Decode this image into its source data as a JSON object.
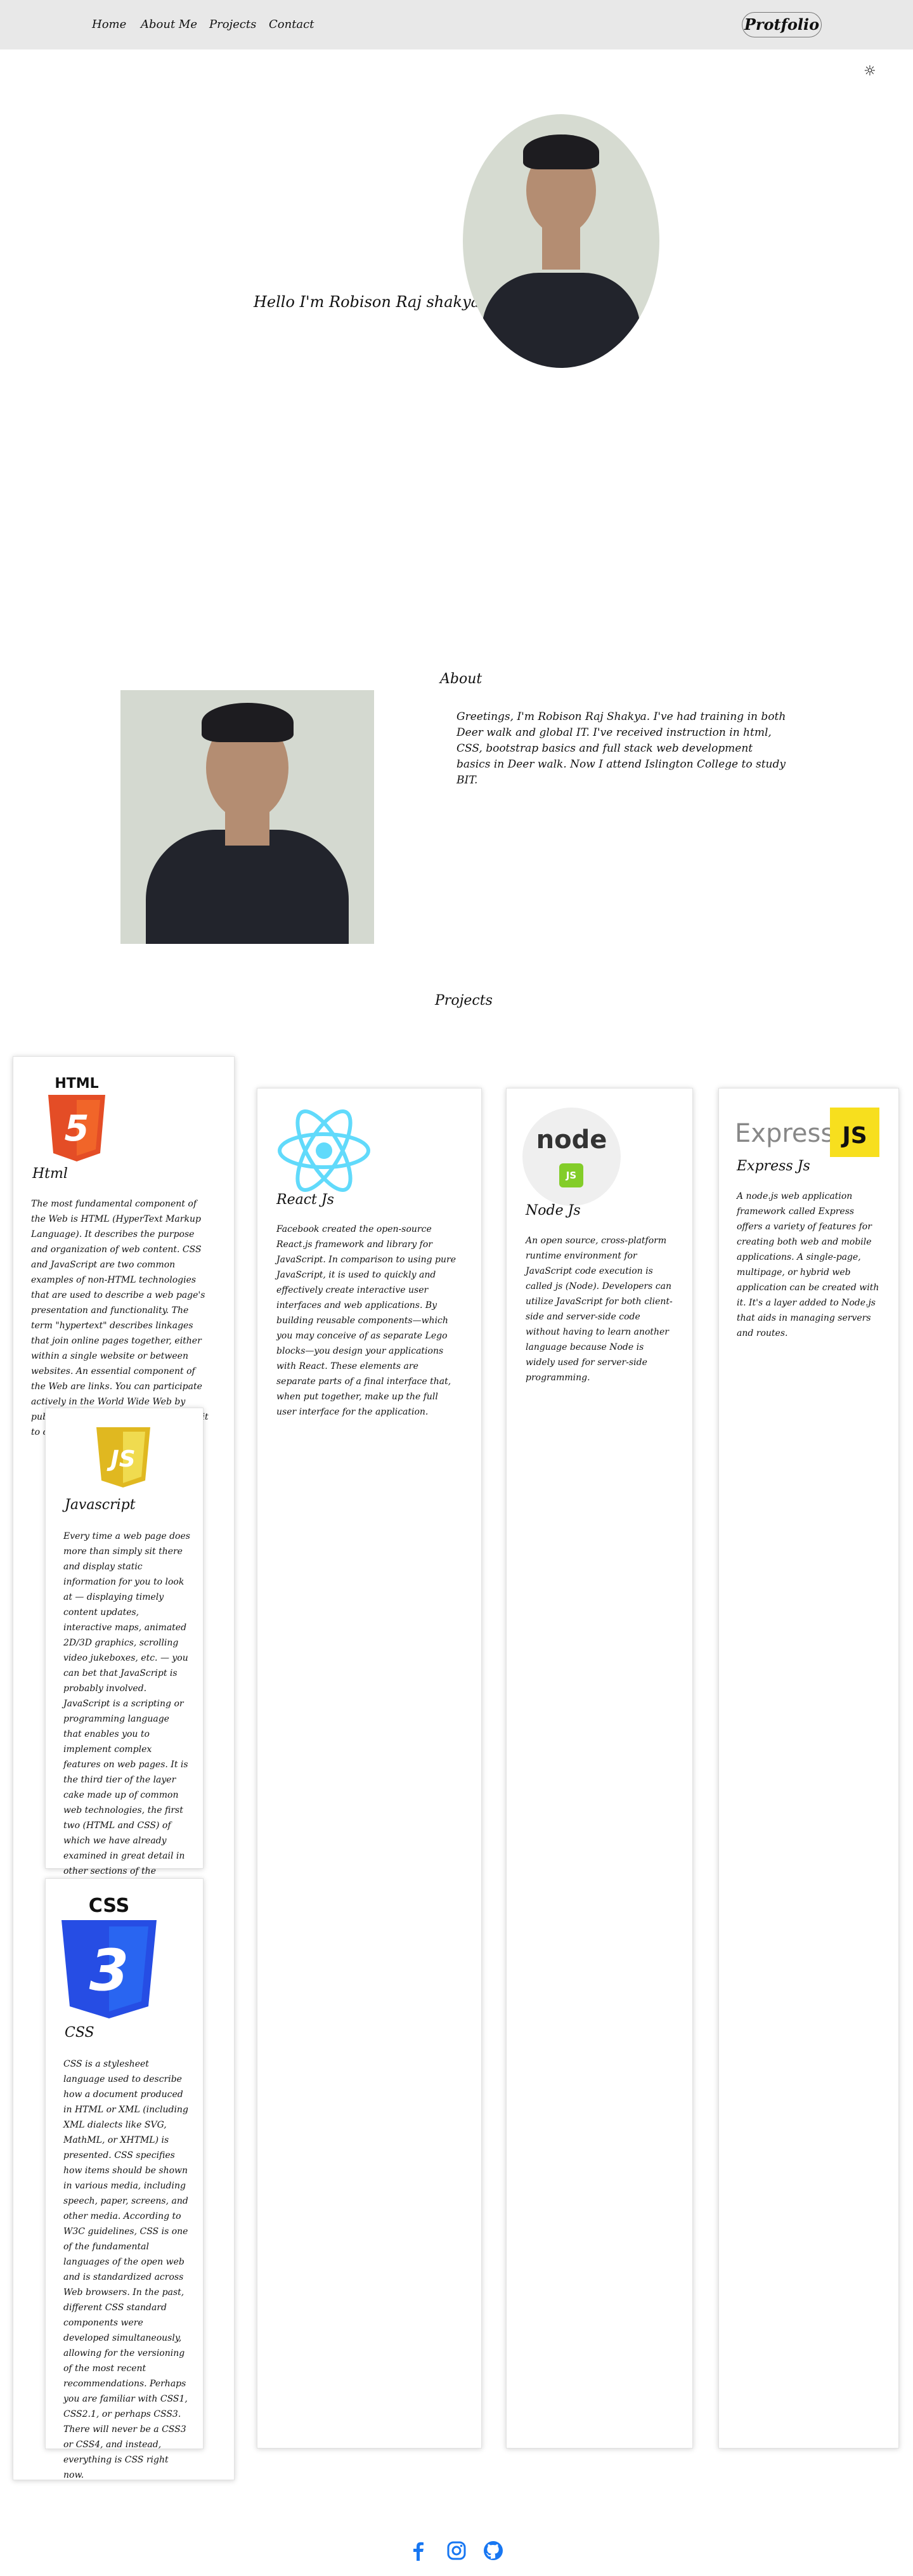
{
  "nav": {
    "items": [
      "Home",
      "About Me",
      "Projects",
      "Contact"
    ],
    "logo": "Protfolio",
    "theme_icon": "sun-icon"
  },
  "hero": {
    "greeting": "Hello I'm Robison Raj shakya"
  },
  "about": {
    "title": "About",
    "text": "Greetings, I'm Robison Raj Shakya. I've had training in both Deer walk and global IT. I've received instruction in html, CSS, bootstrap basics and full stack web development basics in Deer walk. Now I attend Islington College to study BIT."
  },
  "projects": {
    "title": "Projects",
    "cards": [
      {
        "name": "Html",
        "logo_text": "HTML",
        "logo_badge": "5",
        "desc": "The most fundamental component of the Web is HTML (HyperText Markup Language). It describes the purpose and organization of web content. CSS and JavaScript are two common examples of non-HTML technologies that are used to describe a web page's presentation and functionality. The term \"hypertext\" describes linkages that join online pages together, either within a single website or between websites. An essential component of the Web are links. You can participate actively in the World Wide Web by publishing content online and linking it to other people's web pages."
      },
      {
        "name": "Javascript",
        "logo_text": "JS",
        "desc": "Every time a web page does more than simply sit there and display static information for you to look at — displaying timely content updates, interactive maps, animated 2D/3D graphics, scrolling video jukeboxes, etc. — you can bet that JavaScript is probably involved. JavaScript is a scripting or programming language that enables you to implement complex features on web pages. It is the third tier of the layer cake made up of common web technologies, the first two (HTML and CSS) of which we have already examined in great detail in other sections of the Learning Area."
      },
      {
        "name": "CSS",
        "logo_text": "CSS",
        "logo_badge": "3",
        "desc": "CSS is a stylesheet language used to describe how a document produced in HTML or XML (including XML dialects like SVG, MathML, or XHTML) is presented. CSS specifies how items should be shown in various media, including speech, paper, screens, and other media. According to W3C guidelines, CSS is one of the fundamental languages of the open web and is standardized across Web browsers. In the past, different CSS standard components were developed simultaneously, allowing for the versioning of the most recent recommendations. Perhaps you are familiar with CSS1, CSS2.1, or perhaps CSS3. There will never be a CSS3 or CSS4, and instead, everything is CSS right now."
      },
      {
        "name": "React Js",
        "desc": "Facebook created the open-source React.js framework and library for JavaScript. In comparison to using pure JavaScript, it is used to quickly and effectively create interactive user interfaces and web applications. By building reusable components—which you may conceive of as separate Lego blocks—you design your applications with React. These elements are separate parts of a final interface that, when put together, make up the full user interface for the application."
      },
      {
        "name": "Node Js",
        "logo_text": "node",
        "logo_badge": "JS",
        "desc": "An open source, cross-platform runtime environment for JavaScript code execution is called js (Node). Developers can utilize JavaScript for both client-side and server-side code without having to learn another language because Node is widely used for server-side programming."
      },
      {
        "name": "Express Js",
        "logo_text": "Express",
        "logo_badge": "JS",
        "desc": "A node.js web application framework called Express offers a variety of features for creating both web and mobile applications. A single-page, multipage, or hybrid web application can be created with it. It's a layer added to Node.js that aids in managing servers and routes."
      }
    ]
  },
  "footer": {
    "icons": [
      "facebook-icon",
      "instagram-icon",
      "github-icon"
    ]
  },
  "colors": {
    "nav_bg": "#e8e8e8",
    "html_orange": "#e44d26",
    "js_yellow": "#f0db4f",
    "css_blue": "#264de4",
    "react_blue": "#61dafb",
    "node_green": "#83cd29",
    "facebook_blue": "#1877f2"
  }
}
